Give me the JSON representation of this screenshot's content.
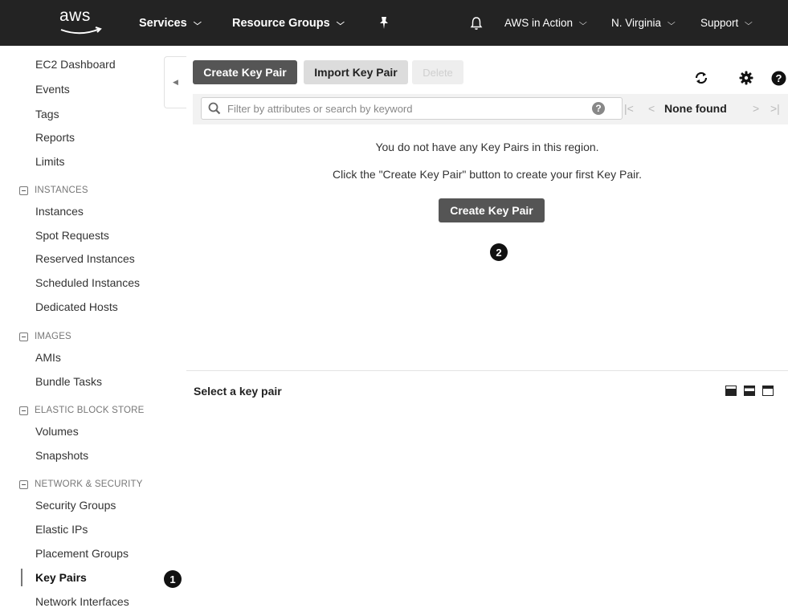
{
  "topnav": {
    "logo_text": "aws",
    "services": "Services",
    "resource_groups": "Resource Groups",
    "account": "AWS in Action",
    "region": "N. Virginia",
    "support": "Support"
  },
  "sidebar": {
    "top_links": [
      "EC2 Dashboard",
      "Events",
      "Tags",
      "Reports",
      "Limits"
    ],
    "sections": [
      {
        "title": "INSTANCES",
        "items": [
          "Instances",
          "Spot Requests",
          "Reserved Instances",
          "Scheduled Instances",
          "Dedicated Hosts"
        ]
      },
      {
        "title": "IMAGES",
        "items": [
          "AMIs",
          "Bundle Tasks"
        ]
      },
      {
        "title": "ELASTIC BLOCK STORE",
        "items": [
          "Volumes",
          "Snapshots"
        ]
      },
      {
        "title": "NETWORK & SECURITY",
        "items": [
          "Security Groups",
          "Elastic IPs",
          "Placement Groups",
          "Key Pairs",
          "Network Interfaces"
        ]
      }
    ],
    "active_item": "Key Pairs",
    "callout_1": "1"
  },
  "toolbar": {
    "create_label": "Create Key Pair",
    "import_label": "Import Key Pair",
    "delete_label": "Delete"
  },
  "filter": {
    "placeholder": "Filter by attributes or search by keyword",
    "status": "None found"
  },
  "main": {
    "empty_line_1": "You do not have any Key Pairs in this region.",
    "empty_line_2": "Click the \"Create Key Pair\" button to create your first Key Pair.",
    "create_center_label": "Create Key Pair",
    "callout_2": "2",
    "lower_title": "Select a key pair"
  },
  "colors": {
    "topnav_bg": "#232323",
    "primary_button": "#555555",
    "secondary_button": "#dcdcdc"
  }
}
